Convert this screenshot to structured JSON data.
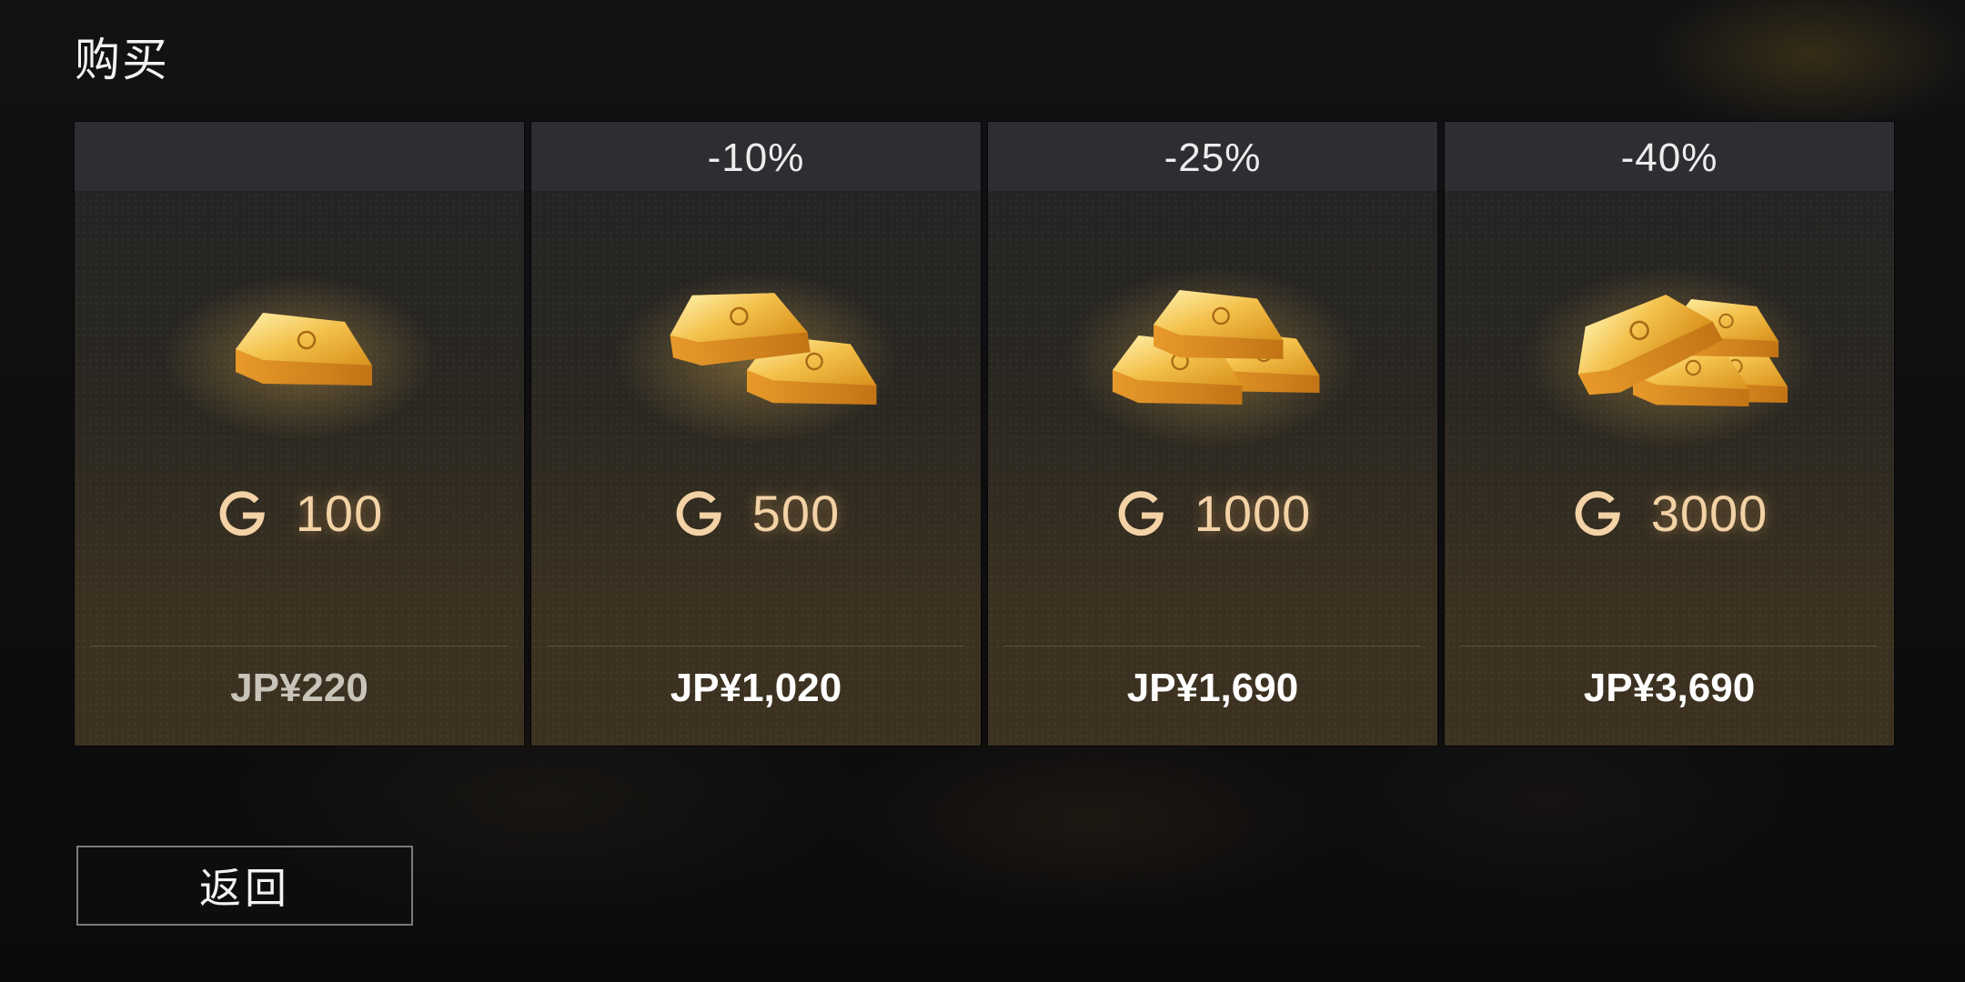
{
  "page": {
    "title": "购买"
  },
  "currency_icon": "gold-g-icon",
  "colors": {
    "amount": "#f3d2a6",
    "gold": "#e8a935",
    "header": "#2d2e31"
  },
  "packs": [
    {
      "discount": "",
      "amount": "100",
      "price": "JP¥220",
      "image": "gold-bar-single"
    },
    {
      "discount": "-10%",
      "amount": "500",
      "price": "JP¥1,020",
      "image": "gold-bars-two"
    },
    {
      "discount": "-25%",
      "amount": "1000",
      "price": "JP¥1,690",
      "image": "gold-bars-stack"
    },
    {
      "discount": "-40%",
      "amount": "3000",
      "price": "JP¥3,690",
      "image": "gold-bars-pile"
    }
  ],
  "footer": {
    "back_label": "返回"
  }
}
